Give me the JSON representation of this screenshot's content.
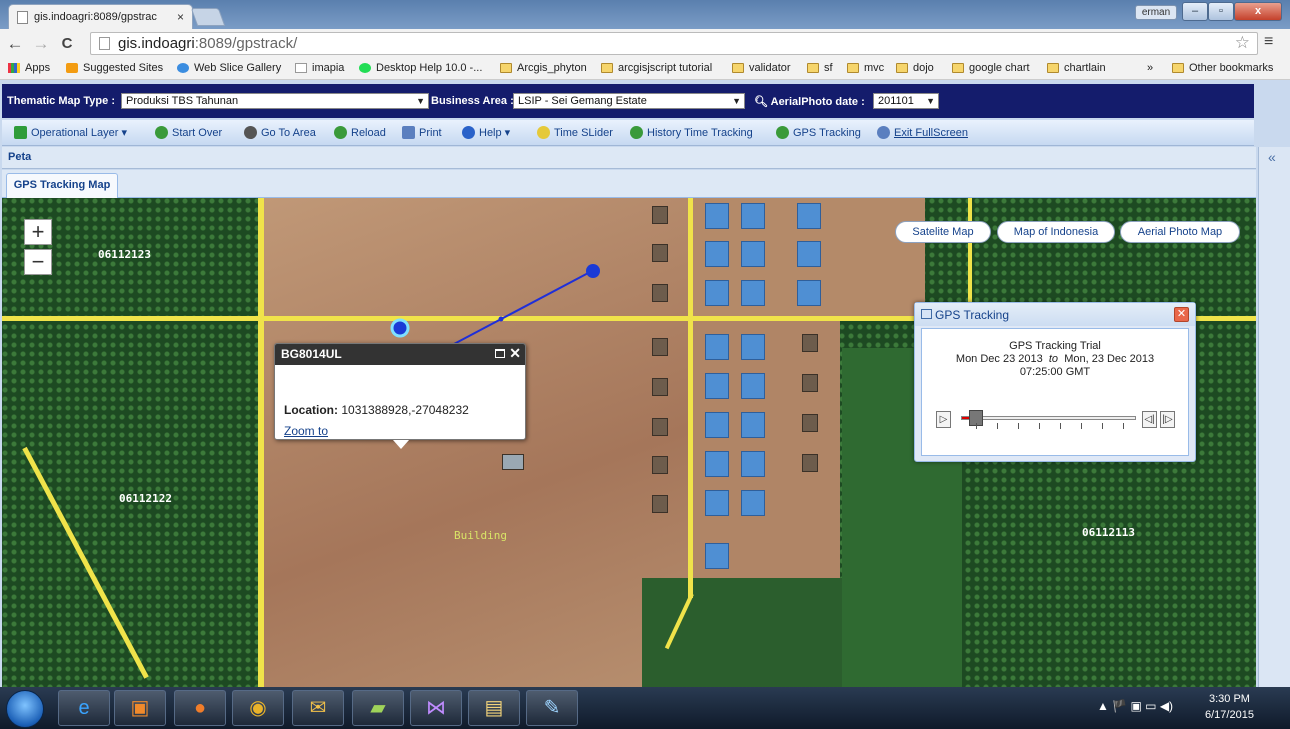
{
  "browser": {
    "tab_title": "gis.indoagri:8089/gpstrac",
    "tab_close": "×",
    "user_badge": "erman",
    "win_min": "–",
    "win_max": "▫",
    "win_close": "x",
    "url_host": "gis.indoagri",
    "url_rest": ":8089/gpstrack/",
    "back_icon": "←",
    "forward_icon": "→",
    "reload_icon": "C",
    "star_icon": "☆",
    "menu_icon": "≡",
    "bookmarks": [
      {
        "label": "Apps"
      },
      {
        "label": "Suggested Sites"
      },
      {
        "label": "Web Slice Gallery"
      },
      {
        "label": "imapia"
      },
      {
        "label": "Desktop Help 10.0 -..."
      },
      {
        "label": "Arcgis_phyton"
      },
      {
        "label": "arcgisjscript tutorial"
      },
      {
        "label": "validator"
      },
      {
        "label": "sf"
      },
      {
        "label": "mvc"
      },
      {
        "label": "dojo"
      },
      {
        "label": "google chart"
      },
      {
        "label": "chartlain"
      },
      {
        "label": "»"
      },
      {
        "label": "Other bookmarks"
      }
    ]
  },
  "header": {
    "thematic_label": "Thematic Map Type :",
    "thematic_value": "Produksi TBS Tahunan",
    "business_label": "Business Area :",
    "business_value": "LSIP - Sei Gemang Estate",
    "aerial_label": "AerialPhoto date :",
    "aerial_value": "201101",
    "dropdown_arrow": "▼"
  },
  "toolbar": {
    "items": [
      {
        "label": "Operational Layer ▾",
        "color": "#2e9c3a"
      },
      {
        "label": "Start Over",
        "color": "#3a9a3a"
      },
      {
        "label": "Go To Area",
        "color": "#555555"
      },
      {
        "label": "Reload",
        "color": "#3a9a3a"
      },
      {
        "label": "Print",
        "color": "#5b7fbf"
      },
      {
        "label": "Help ▾",
        "color": "#2a62c9"
      },
      {
        "label": "Time SLider",
        "color": "#e5c93a"
      },
      {
        "label": "History Time Tracking",
        "color": "#3a9a3a"
      },
      {
        "label": "GPS Tracking",
        "color": "#3a9a3a"
      },
      {
        "label": "Exit FullScreen",
        "color": "#5b7fbf"
      }
    ]
  },
  "panel": {
    "title": "Peta",
    "collapse_icon": "«",
    "tab": "GPS Tracking Map"
  },
  "map": {
    "zoom_in": "+",
    "zoom_out": "−",
    "labels": [
      "06112123",
      "06112122",
      "06112113",
      "Building"
    ],
    "basemap_buttons": [
      "Satelite Map",
      "Map of Indonesia",
      "Aerial Photo Map"
    ],
    "popup": {
      "title": "BG8014UL",
      "location_label": "Location:",
      "location_value": "1031388928,-27048232",
      "zoom_link": "Zoom to",
      "close": "✕"
    },
    "gps_window": {
      "title": "GPS Tracking",
      "close": "✕",
      "line1": "GPS Tracking Trial",
      "line2_start": "Mon Dec 23 2013",
      "line2_to": "to",
      "line2_end": "Mon, 23 Dec 2013",
      "line3": "07:25:00 GMT",
      "play": "▷",
      "prev": "◁|",
      "next": "|▷"
    }
  },
  "taskbar": {
    "apps": [
      "ie-icon",
      "media-icon",
      "firefox-icon",
      "chrome-icon",
      "outlook-icon",
      "notes-icon",
      "visual-studio-icon",
      "explorer-icon",
      "paint-icon"
    ],
    "tray": "▲  🏴  ▣  ▭  ◀)",
    "time": "3:30 PM",
    "date": "6/17/2015"
  }
}
